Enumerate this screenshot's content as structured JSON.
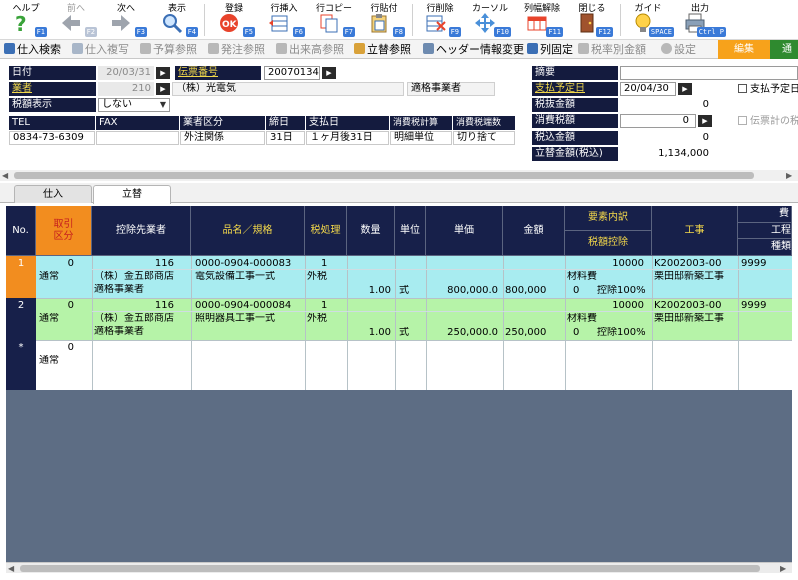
{
  "toolbar": {
    "help": {
      "label": "ヘルプ",
      "key": "F1"
    },
    "prev": {
      "label": "前へ",
      "key": "F2"
    },
    "next": {
      "label": "次へ",
      "key": "F3"
    },
    "show": {
      "label": "表示",
      "key": "F4"
    },
    "register": {
      "label": "登録",
      "key": "F5"
    },
    "row_insert": {
      "label": "行挿入",
      "key": "F6"
    },
    "row_copy": {
      "label": "行コピー",
      "key": "F7"
    },
    "row_paste": {
      "label": "行貼付",
      "key": "F8"
    },
    "row_delete": {
      "label": "行削除",
      "key": "F9"
    },
    "cursor": {
      "label": "カーソル",
      "key": "F10"
    },
    "col_width_reset": {
      "label": "列幅解除",
      "key": "F11"
    },
    "close": {
      "label": "閉じる",
      "key": "F12"
    },
    "guide": {
      "label": "ガイド",
      "key": "SPACE"
    },
    "output": {
      "label": "出力",
      "key": "Ctrl P"
    }
  },
  "menubar": {
    "items": [
      "仕入検索",
      "仕入複写",
      "予算参照",
      "発注参照",
      "出来高参照",
      "立替参照",
      "ヘッダー情報変更",
      "列固定",
      "税率別金額",
      "設定"
    ],
    "mode_edit": "編集",
    "mode_next": "通常"
  },
  "header": {
    "date_label": "日付",
    "date_value": "20/03/31",
    "slip_label": "伝票番号",
    "slip_value": "20070134",
    "vendor_label": "業者",
    "vendor_code": "210",
    "vendor_name": "（株）光電気",
    "vendor_type": "適格事業者",
    "tax_display_label": "税額表示",
    "tax_display_value": "しない",
    "tel_label": "TEL",
    "fax_label": "FAX",
    "vendor_category_label": "業者区分",
    "closing_label": "締日",
    "payment_label": "支払日",
    "tax_calc_label": "消費税計算",
    "tax_round_label": "消費税端数",
    "tel_value": "0834-73-6309",
    "fax_value": "",
    "vendor_category_value": "外注関係",
    "closing_value": "31日",
    "payment_value": "１ヶ月後31日",
    "tax_calc_value": "明細単位",
    "tax_round_value": "切り捨て",
    "summary_label": "摘要",
    "summary_value": "",
    "pay_plan_label": "支払予定日",
    "pay_plan_value": "20/04/30",
    "pay_plan_check": "支払予定日",
    "excl_label": "税抜金額",
    "excl_value": "0",
    "tax_label": "消費税額",
    "tax_value": "0",
    "slip_total_check": "伝票計の税",
    "incl_label": "税込金額",
    "incl_value": "0",
    "advance_label": "立替金額(税込)",
    "advance_value": "1,134,000"
  },
  "tabs": [
    "仕入",
    "立替"
  ],
  "grid": {
    "headers": {
      "no": "No.",
      "kubun": "取引\n区分",
      "deduct": "控除先業者",
      "item": "品名／規格",
      "taxproc": "税処理",
      "qty": "数量",
      "unit": "単位",
      "price": "単価",
      "amount": "金額",
      "element": "要素内訳",
      "taxded": "税額控除",
      "koji": "工事",
      "hi": "費",
      "kou": "工程",
      "shu": "種類"
    },
    "rows": [
      {
        "no": "1",
        "code": "0",
        "kubun": "通常",
        "deduct_code": "116",
        "deduct_name": "（株）金五郎商店",
        "deduct_type": "適格事業者",
        "item_code": "0000-0904-000083",
        "item_name": "電気設備工事一式",
        "tax_code": "1",
        "tax_name": "外税",
        "qty": "1.00",
        "unit": "式",
        "price": "800,000.0",
        "amount": "800,000",
        "el_code": "10000",
        "el_name": "材料費",
        "el_rate": "0",
        "el_ded": "控除100%",
        "koji_code": "K2002003-00",
        "koji_name": "栗田邸新築工事",
        "hi_code": "9999"
      },
      {
        "no": "2",
        "code": "0",
        "kubun": "通常",
        "deduct_code": "116",
        "deduct_name": "（株）金五郎商店",
        "deduct_type": "適格事業者",
        "item_code": "0000-0904-000084",
        "item_name": "照明器具工事一式",
        "tax_code": "1",
        "tax_name": "外税",
        "qty": "1.00",
        "unit": "式",
        "price": "250,000.0",
        "amount": "250,000",
        "el_code": "10000",
        "el_name": "材料費",
        "el_rate": "0",
        "el_ded": "控除100%",
        "koji_code": "K2002003-00",
        "koji_name": "栗田邸新築工事",
        "hi_code": "9999"
      }
    ],
    "new_row": {
      "no": "*",
      "code": "0",
      "kubun": "通常"
    }
  },
  "colors": {
    "header_navy": "#17204a",
    "row1_bg": "#a8ecf0",
    "row2_bg": "#b6f3a8",
    "label_yellow": "#f1d84b",
    "mode_orange": "#f7a21b"
  }
}
